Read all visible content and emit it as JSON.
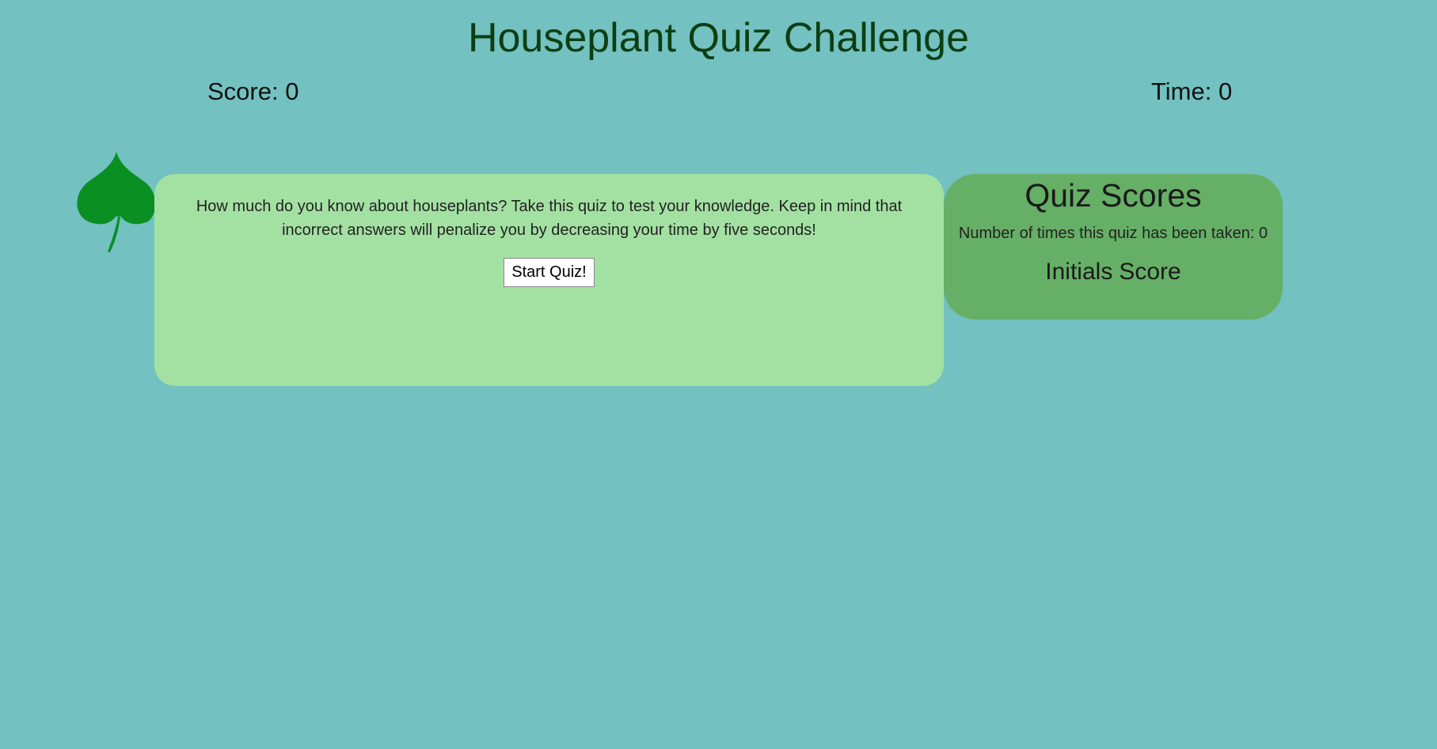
{
  "header": {
    "title": "Houseplant Quiz Challenge",
    "score_text": "Score: 0",
    "time_text": "Time: 0"
  },
  "quiz": {
    "intro": "How much do you know about houseplants? Take this quiz to test your knowledge. Keep in mind that incorrect answers will penalize you by decreasing your time by five seconds!",
    "start_label": "Start Quiz!"
  },
  "scores": {
    "heading": "Quiz Scores",
    "times_taken": "Number of times this quiz has been taken: 0",
    "columns": [
      "Initials",
      "Score"
    ]
  },
  "icons": {
    "logo": "leaf-icon"
  },
  "colors": {
    "background": "#73c1c1",
    "quiz_card": "#a3e1a2",
    "scores_card": "#66af66",
    "leaf": "#0a8f23",
    "title": "#0b3f12"
  }
}
